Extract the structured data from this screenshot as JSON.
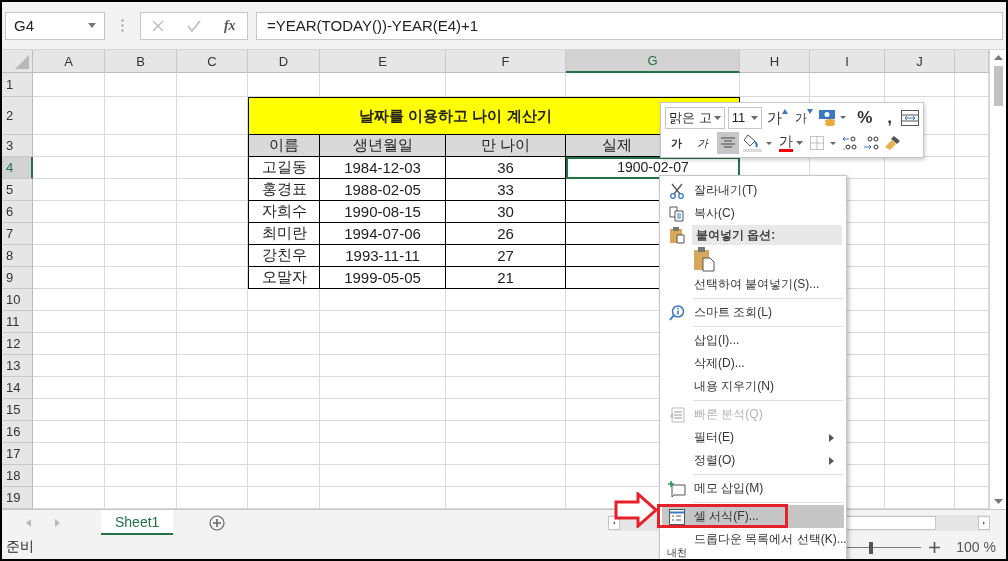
{
  "name_box": {
    "value": "G4"
  },
  "formula_bar": {
    "function_label": "fx",
    "formula": "=YEAR(TODAY())-YEAR(E4)+1"
  },
  "columns": [
    {
      "label": "A",
      "selected": false
    },
    {
      "label": "B",
      "selected": false
    },
    {
      "label": "C",
      "selected": false
    },
    {
      "label": "D",
      "selected": false
    },
    {
      "label": "E",
      "selected": false
    },
    {
      "label": "F",
      "selected": false
    },
    {
      "label": "G",
      "selected": true
    },
    {
      "label": "H",
      "selected": false
    },
    {
      "label": "I",
      "selected": false
    },
    {
      "label": "J",
      "selected": false
    }
  ],
  "rows": [
    {
      "label": "1",
      "selected": false
    },
    {
      "label": "2",
      "selected": false
    },
    {
      "label": "3",
      "selected": false
    },
    {
      "label": "4",
      "selected": true
    },
    {
      "label": "5",
      "selected": false
    },
    {
      "label": "6",
      "selected": false
    },
    {
      "label": "7",
      "selected": false
    },
    {
      "label": "8",
      "selected": false
    },
    {
      "label": "9",
      "selected": false
    },
    {
      "label": "10",
      "selected": false
    },
    {
      "label": "11",
      "selected": false
    },
    {
      "label": "12",
      "selected": false
    },
    {
      "label": "13",
      "selected": false
    },
    {
      "label": "14",
      "selected": false
    },
    {
      "label": "15",
      "selected": false
    },
    {
      "label": "16",
      "selected": false
    },
    {
      "label": "17",
      "selected": false
    },
    {
      "label": "18",
      "selected": false
    },
    {
      "label": "19",
      "selected": false
    }
  ],
  "table": {
    "title": "날짜를 이용하고 나이 계산기",
    "headers": [
      "이름",
      "생년월일",
      "만 나이",
      "실제"
    ],
    "rows": [
      {
        "cells": [
          {
            "text": "고길동",
            "selected": false
          },
          {
            "text": "1984-12-03",
            "selected": false
          },
          {
            "text": "36",
            "selected": false
          },
          {
            "text": "1900-02-07",
            "selected": true
          }
        ]
      },
      {
        "cells": [
          {
            "text": "홍경표",
            "selected": false
          },
          {
            "text": "1988-02-05",
            "selected": false
          },
          {
            "text": "33",
            "selected": false
          },
          {
            "selected": false
          }
        ]
      },
      {
        "cells": [
          {
            "text": "자희수",
            "selected": false
          },
          {
            "text": "1990-08-15",
            "selected": false
          },
          {
            "text": "30",
            "selected": false
          },
          {
            "selected": false
          }
        ]
      },
      {
        "cells": [
          {
            "text": "최미란",
            "selected": false
          },
          {
            "text": "1994-07-06",
            "selected": false
          },
          {
            "text": "26",
            "selected": false
          },
          {
            "selected": false
          }
        ]
      },
      {
        "cells": [
          {
            "text": "강친우",
            "selected": false
          },
          {
            "text": "1993-11-11",
            "selected": false
          },
          {
            "text": "27",
            "selected": false
          },
          {
            "selected": false
          }
        ]
      },
      {
        "cells": [
          {
            "text": "오말자",
            "selected": false
          },
          {
            "text": "1999-05-05",
            "selected": false
          },
          {
            "text": "21",
            "selected": false
          },
          {
            "selected": false
          }
        ]
      }
    ]
  },
  "mini_toolbar": {
    "row1": [
      {
        "kind": "font_box",
        "text": "맑은 고"
      },
      {
        "kind": "size_box",
        "text": "11"
      },
      {
        "kind": "grow",
        "text": "가"
      },
      {
        "kind": "shrink",
        "text": "가"
      },
      {
        "kind": "accounting"
      },
      {
        "kind": "glyph",
        "text": "%"
      },
      {
        "kind": "glyph",
        "text": ","
      },
      {
        "kind": "wrap"
      }
    ],
    "row2": [
      {
        "kind": "bold",
        "text": "가",
        "on": false
      },
      {
        "kind": "italic",
        "text": "가",
        "on": false
      },
      {
        "kind": "align",
        "on": true
      },
      {
        "kind": "fill"
      },
      {
        "kind": "font_color",
        "text": "가"
      },
      {
        "kind": "borders"
      },
      {
        "kind": "more_decimals"
      },
      {
        "kind": "fewer_decimals"
      },
      {
        "kind": "painter"
      }
    ]
  },
  "context_menu": [
    {
      "kind": "cut",
      "label": "잘라내기(T)",
      "selected": false,
      "disabled": false,
      "submenu": false
    },
    {
      "kind": "copy",
      "label": "복사(C)",
      "selected": false,
      "disabled": false,
      "submenu": false
    },
    {
      "kind": "paste_header",
      "label": "붙여넣기 옵션:"
    },
    {
      "kind": "paste_options"
    },
    {
      "kind": "plain",
      "label": "선택하여 붙여넣기(S)...",
      "selected": false,
      "disabled": false,
      "submenu": false
    },
    {
      "kind": "separator"
    },
    {
      "kind": "lookup",
      "label": "스마트 조회(L)",
      "selected": false,
      "disabled": false,
      "submenu": false
    },
    {
      "kind": "separator"
    },
    {
      "kind": "plain",
      "label": "삽입(I)...",
      "selected": false,
      "disabled": false,
      "submenu": false
    },
    {
      "kind": "plain",
      "label": "삭제(D)...",
      "selected": false,
      "disabled": false,
      "submenu": false
    },
    {
      "kind": "plain",
      "label": "내용 지우기(N)",
      "selected": false,
      "disabled": false,
      "submenu": false
    },
    {
      "kind": "separator"
    },
    {
      "kind": "quick_analysis",
      "label": "빠른 분석(Q)",
      "selected": false,
      "disabled": true,
      "submenu": false
    },
    {
      "kind": "plain",
      "label": "필터(E)",
      "selected": false,
      "disabled": false,
      "submenu": true
    },
    {
      "kind": "plain",
      "label": "정렬(O)",
      "selected": false,
      "disabled": false,
      "submenu": true
    },
    {
      "kind": "separator"
    },
    {
      "kind": "comment",
      "label": "메모 삽입(M)",
      "selected": false,
      "disabled": false,
      "submenu": false
    },
    {
      "kind": "separator"
    },
    {
      "kind": "format",
      "label": "셀 서식(F)...",
      "selected": true,
      "disabled": false,
      "submenu": false
    },
    {
      "kind": "plain",
      "label": "드롭다운 목록에서 선택(K)...",
      "selected": false,
      "disabled": false,
      "submenu": false
    },
    {
      "kind": "phonetic",
      "icon_text": "내천",
      "selected": false,
      "disabled": false,
      "submenu": false
    }
  ],
  "sheet_tabs": [
    {
      "label": "Sheet1",
      "selected": true
    }
  ],
  "status_bar": {
    "text": "준비",
    "zoom": {
      "level": 0.5
    },
    "zoom_label": "100 %"
  }
}
